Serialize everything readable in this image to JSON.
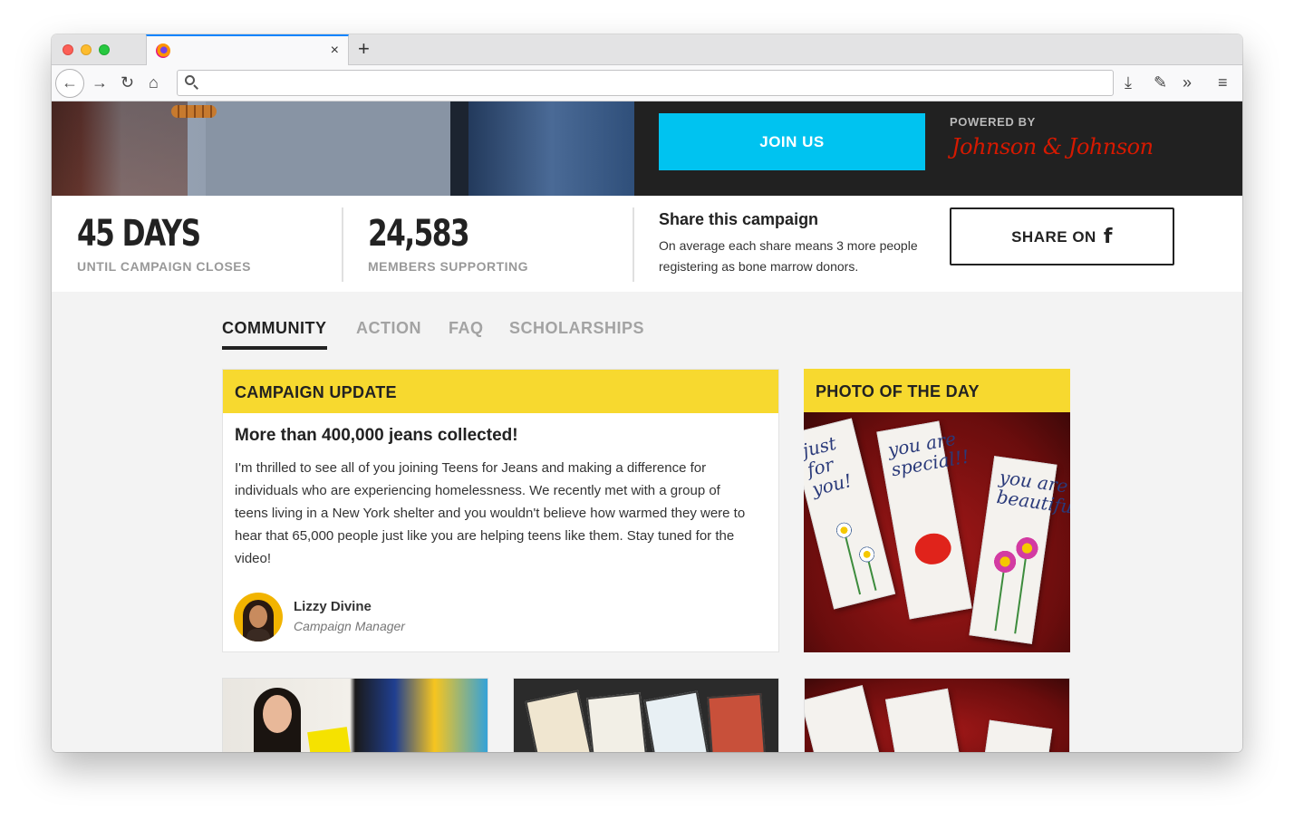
{
  "browser": {
    "tab": {
      "title": "",
      "close_glyph": "×"
    },
    "new_tab_glyph": "+",
    "nav": {
      "back_glyph": "←",
      "forward_glyph": "→",
      "reload_glyph": "↻",
      "home_glyph": "⌂"
    },
    "url": {
      "value": "",
      "placeholder": ""
    },
    "toolbar": {
      "download_glyph": "⤓",
      "tools_glyph": "✎",
      "overflow_glyph": "»",
      "menu_glyph": "≡"
    }
  },
  "hero": {
    "join_label": "JOIN US",
    "powered_by": "POWERED BY",
    "sponsor_logo_text": "Johnson & Johnson"
  },
  "stats": [
    {
      "value": "45 DAYS",
      "label": "UNTIL CAMPAIGN CLOSES"
    },
    {
      "value": "24,583",
      "label": "MEMBERS SUPPORTING"
    }
  ],
  "share": {
    "title": "Share this campaign",
    "description": "On average each share means 3 more people registering as bone marrow donors.",
    "button_label": "SHARE ON",
    "button_icon": "facebook-icon"
  },
  "tabs": [
    {
      "label": "COMMUNITY",
      "active": true
    },
    {
      "label": "ACTION",
      "active": false
    },
    {
      "label": "FAQ",
      "active": false
    },
    {
      "label": "SCHOLARSHIPS",
      "active": false
    }
  ],
  "campaign_update": {
    "header": "CAMPAIGN UPDATE",
    "title": "More than 400,000 jeans collected!",
    "body": "I'm thrilled to see all of you joining Teens for Jeans and making a difference for individuals who are experiencing homelessness. We recently met with a group of teens living in a New York shelter and you wouldn't believe how warmed they were to hear that 65,000 people just like you are helping teens like them. Stay tuned for the video!",
    "author": {
      "name": "Lizzy Divine",
      "role": "Campaign Manager"
    }
  },
  "photo_of_the_day": {
    "header": "PHOTO OF THE DAY",
    "bookmark_texts": [
      "just for you!",
      "you are special!!",
      "you are beautiful!"
    ]
  },
  "colors": {
    "accent_cyan": "#00c3f0",
    "highlight_yellow": "#f7d92f",
    "sponsor_red": "#d51900",
    "hero_dark": "#212121"
  }
}
